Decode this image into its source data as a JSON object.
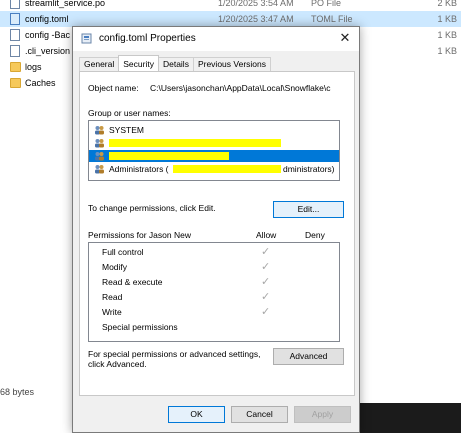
{
  "explorer": {
    "files": [
      {
        "name": "streamlit_service.po",
        "date": "1/20/2025 3:54 AM",
        "type": "PO File",
        "size": "2 KB",
        "icon": "doc-icon",
        "selected": false
      },
      {
        "name": "config.toml",
        "date": "1/20/2025 3:47 AM",
        "type": "TOML File",
        "size": "1 KB",
        "icon": "doc-icon",
        "selected": true
      },
      {
        "name": "config -Bac",
        "date": "",
        "type": "",
        "size": "1 KB",
        "icon": "doc-icon",
        "selected": false
      },
      {
        "name": ".cli_version",
        "date": "",
        "type": "",
        "size": "1 KB",
        "icon": "doc-icon",
        "selected": false
      },
      {
        "name": "logs",
        "date": "",
        "type": "",
        "size": "",
        "icon": "folder-icon",
        "selected": false
      },
      {
        "name": "Caches",
        "date": "",
        "type": "",
        "size": "",
        "icon": "folder-icon",
        "selected": false
      }
    ],
    "status_text": "68 bytes"
  },
  "dialog": {
    "title": "config.toml Properties",
    "close_glyph": "✕",
    "tabs": [
      "General",
      "Security",
      "Details",
      "Previous Versions"
    ],
    "active_tab": "Security",
    "object_name_label": "Object name:",
    "object_name_value": "C:\\Users\\jasonchan\\AppData\\Local\\Snowflake\\c",
    "group_label": "Group or user names:",
    "users": [
      {
        "name": "SYSTEM",
        "selected": false,
        "redacted": false
      },
      {
        "name": "",
        "selected": false,
        "redacted": true
      },
      {
        "name": "",
        "selected": true,
        "redacted": true
      },
      {
        "name": "Administrators (",
        "suffix": "dministrators)",
        "selected": false,
        "redacted": true
      }
    ],
    "change_text": "To change permissions, click Edit.",
    "edit_button": "Edit...",
    "permissions_for": "Permissions for Jason New",
    "allow_header": "Allow",
    "deny_header": "Deny",
    "permissions": [
      {
        "name": "Full control",
        "allow": true
      },
      {
        "name": "Modify",
        "allow": true
      },
      {
        "name": "Read & execute",
        "allow": true
      },
      {
        "name": "Read",
        "allow": true
      },
      {
        "name": "Write",
        "allow": true
      },
      {
        "name": "Special permissions",
        "allow": false
      }
    ],
    "check_glyph": "✓",
    "advanced_text_line1": "For special permissions or advanced settings,",
    "advanced_text_line2": "click Advanced.",
    "advanced_button": "Advanced",
    "ok_button": "OK",
    "cancel_button": "Cancel",
    "apply_button": "Apply"
  },
  "colors": {
    "selection_blue": "#0078d7",
    "explorer_selection": "#cce8ff",
    "redaction_yellow": "#ffff00"
  }
}
